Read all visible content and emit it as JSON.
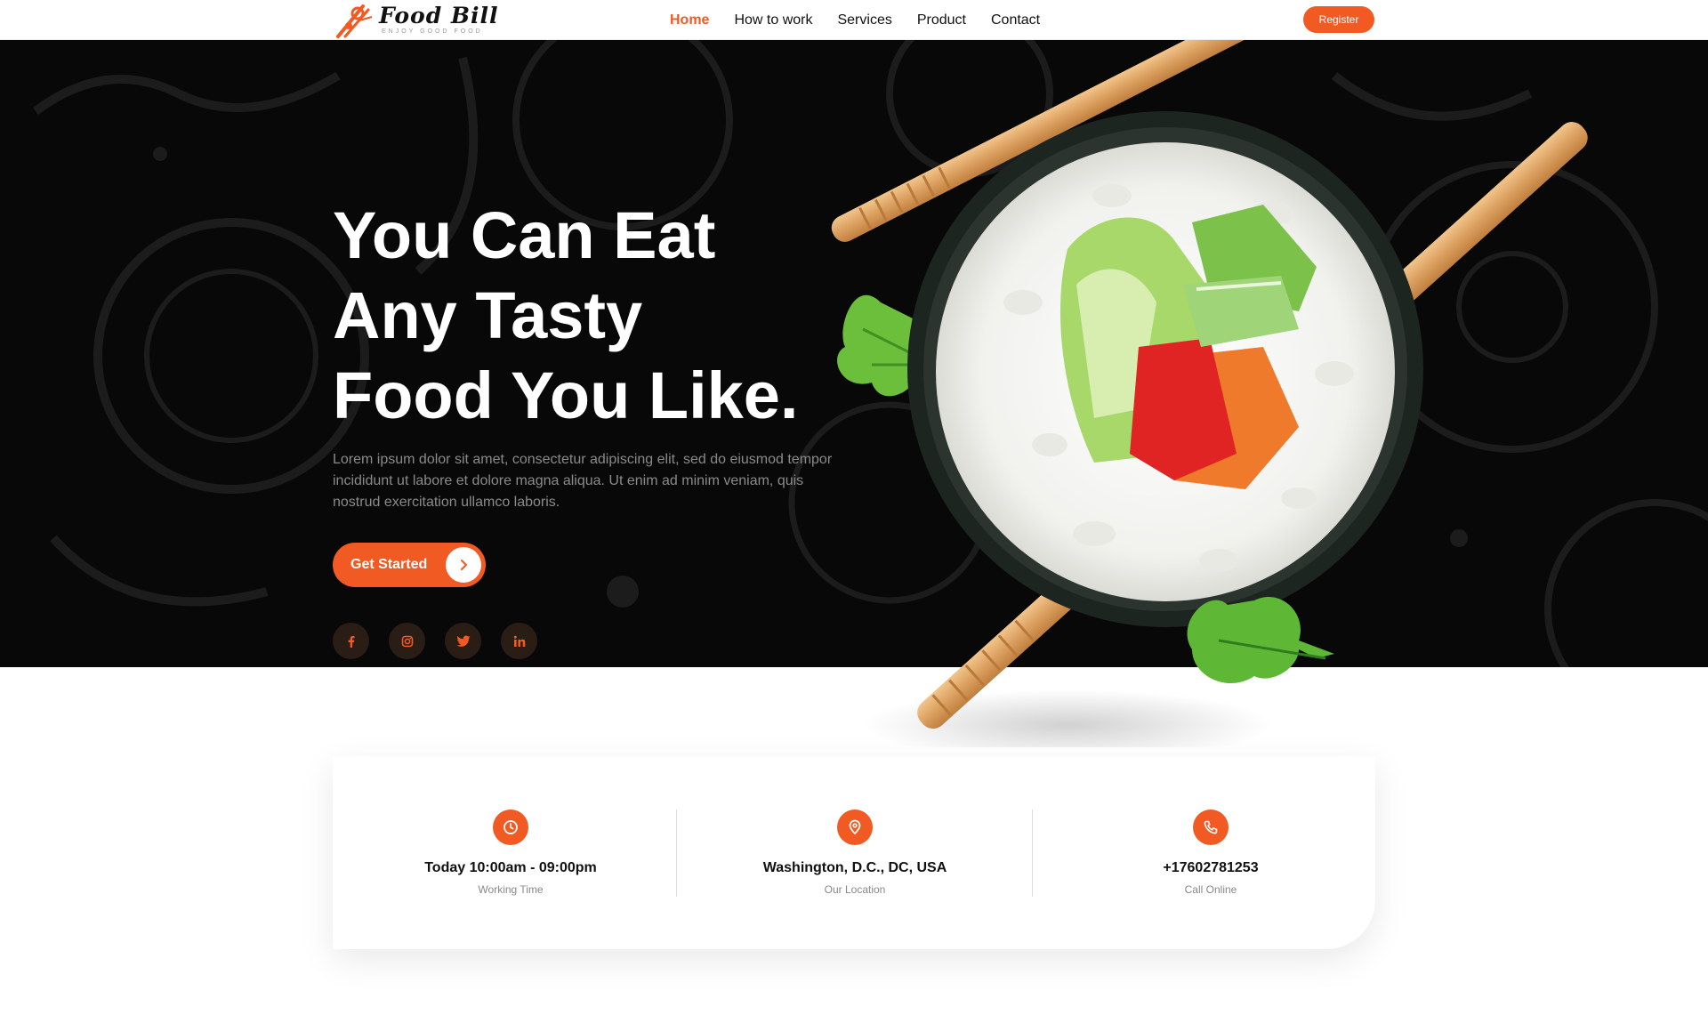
{
  "brand": {
    "name": "Food Bill",
    "tagline": "ENJOY GOOD FOOD"
  },
  "nav": {
    "links": [
      "Home",
      "How to work",
      "Services",
      "Product",
      "Contact"
    ],
    "active": "Home",
    "register_label": "Register"
  },
  "hero": {
    "title_lines": [
      "You Can Eat",
      "Any Tasty",
      "Food You Like."
    ],
    "description": "Lorem ipsum dolor sit amet, consectetur adipiscing elit, sed do eiusmod tempor incididunt ut labore et dolore magna aliqua. Ut enim ad minim veniam, quis nostrud exercitation ullamco laboris.",
    "cta_label": "Get Started",
    "cta_icon": "chevron-right-icon",
    "socials": [
      {
        "name": "facebook-icon",
        "glyph": "f"
      },
      {
        "name": "instagram-icon",
        "glyph": "◎"
      },
      {
        "name": "twitter-icon",
        "glyph": "🐦"
      },
      {
        "name": "linkedin-icon",
        "glyph": "in"
      }
    ]
  },
  "info": [
    {
      "icon": "clock-icon",
      "title": "Today 10:00am - 09:00pm",
      "subtitle": "Working Time"
    },
    {
      "icon": "map-pin-icon",
      "title": "Washington, D.C., DC, USA",
      "subtitle": "Our Location"
    },
    {
      "icon": "phone-icon",
      "title": "+17602781253",
      "subtitle": "Call Online"
    }
  ],
  "colors": {
    "accent": "#f15a22",
    "hero_bg": "#080808",
    "text_dark": "#111111",
    "text_muted": "#888888"
  }
}
